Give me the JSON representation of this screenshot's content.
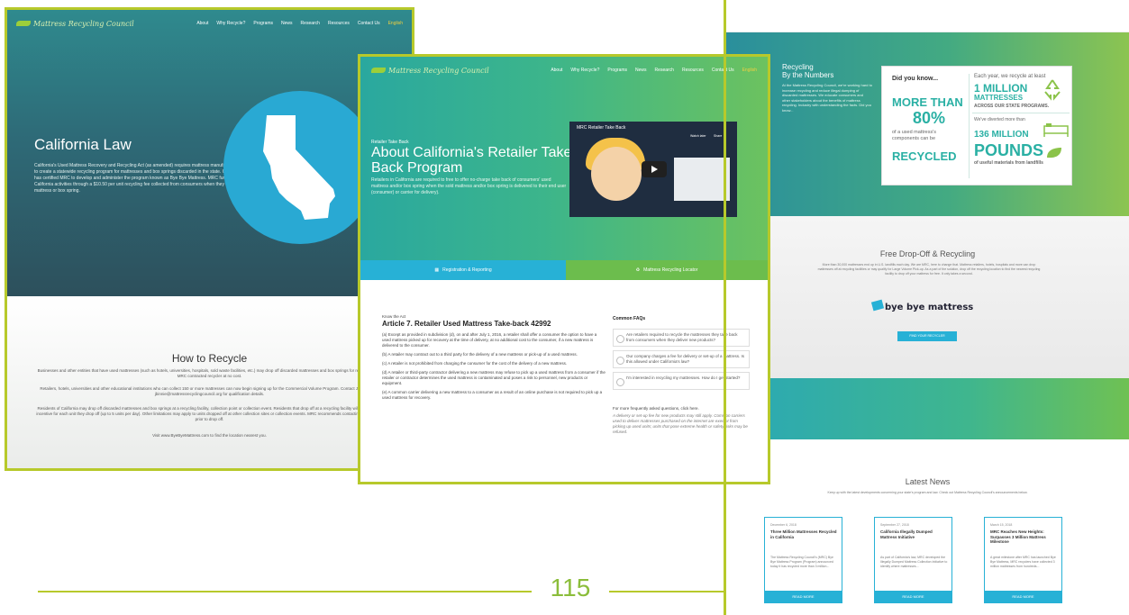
{
  "page_number": "115",
  "nav": {
    "logo": "Mattress Recycling Council",
    "links": [
      "About",
      "Why Recycle?",
      "Programs",
      "News",
      "Research",
      "Resources",
      "Contact Us"
    ],
    "language": "English"
  },
  "left_page": {
    "title": "California Law",
    "body": "California's Used Mattress Recovery and Recycling Act (as amended) requires mattress manufacturers to create a statewide recycling program for mattresses and box springs discarded in the state. California has certified MRC to develop and administer the program known as Bye Bye Mattress. MRC funds its California activities through a $10.50 per unit recycling fee collected from consumers when they buy a mattress or box spring.",
    "how_title": "How to Recycle",
    "how_p1": "Businesses and other entities that have used mattresses (such as hotels, universities, hospitals, sold waste facilities, etc.) may drop off discarded mattresses and box springs for recycling at an MRC contracted recycler at no cost.",
    "how_p2": "Retailers, hotels, universities and other educational institutions who can collect 150 or more mattresses can now begin signing up for the Commercial Volume Program. Contact Jay Binnie at jbinnie@mattressrecyclingcouncil.org for qualification details.",
    "how_p3": "Residents of California may drop off discarded mattresses and box springs at a recycling facility, collection point or collection event. Residents that drop off at a recycling facility will receive a $3 incentive for each unit they drop off (up to 5 units per day). Other limitations may apply to units dropped off at other collection sites or collection events. MRC recommends contacting the location prior to drop off.",
    "how_p4": "Visit www.ByeByeMattress.com to find the location nearest you."
  },
  "mid_page": {
    "kicker": "Retailer Take Back",
    "title": "About California's Retailer Take Back Program",
    "body": "Retailers in California are required to free to offer no-charge take back of consumers' used mattress and/or box spring when the sold mattress and/or box spring is delivered to their end user (consumer) or carrier for delivery).",
    "video_title": "MRC Retailer Take Back",
    "video_watch_later": "Watch later",
    "video_share": "Share",
    "tab1": "Registration & Reporting",
    "tab2": "Mattress Recycling Locator",
    "know_label": "Know the Act",
    "article_title": "Article 7. Retailer Used Mattress Take-back 42992",
    "law": [
      "(a) Except as provided in subdivision (d), on and after July 1, 2016, a retailer shall offer a consumer the option to have a used mattress picked up for recovery at the time of delivery, at no additional cost to the consumer, if a new mattress is delivered to the consumer.",
      "(b) A retailer may contract out to a third party for the delivery of a new mattress or pick-up of a used mattress.",
      "(c) A retailer is not prohibited from charging the consumer for the cost of the delivery of a new mattress.",
      "(d) A retailer or third-party contractor delivering a new mattress may refuse to pick up a used mattress from a consumer if the retailer or contractor determines the used mattress is contaminated and poses a risk to personnel, new products or equipment.",
      "(e) A common carrier delivering a new mattress to a consumer as a result of an online purchase is not required to pick up a used mattress for recovery."
    ],
    "faq_title": "Common FAQs",
    "faqs": [
      "Are retailers required to recycle the mattresses they take back from consumers when they deliver new products?",
      "Our company charges a fee for delivery or set-up of a mattress. Is this allowed under California's law?",
      "I'm interested in recycling my mattresses. How do I get started?"
    ],
    "faq_more": "For more frequently asked questions, click here.",
    "faq_note": "A delivery or set-up fee for new products may still apply. Common carriers used to deliver mattresses purchased on the internet are exempt from picking up used units; units that pose extreme health or safety risks may be refused."
  },
  "right_page": {
    "rbn_title_1": "Recycling",
    "rbn_title_2": "By the Numbers",
    "rbn_body": "At the Mattress Recycling Council, we're working hard to increase recycling and reduce illegal dumping of discarded mattresses. We educate consumers and other stakeholders about the benefits of mattress recycling. Industry with understanding the facts. Did you know...",
    "did_you_know": "Did you know...",
    "more_than": "MORE THAN",
    "pct": "80%",
    "used_mattress": "of a used mattress's components can be",
    "recycled": "RECYCLED",
    "each_year": "Each year, we recycle at least",
    "one_million": "1 MILLION",
    "mattresses": "MATTRESSES",
    "across": "ACROSS OUR STATE PROGRAMS.",
    "diverted": "We've diverted more than",
    "m136": "136 MILLION",
    "pounds": "POUNDS",
    "useful": "of useful materials from landfills",
    "fd_title": "Free Drop-Off & Recycling",
    "fd_body": "More than 30,000 mattresses end up in U.S. landfills each day. We are MRC, here to change that. Mattress retailers, hotels, hospitals and more can drop mattresses off at recycling facilities or may qualify for Large Volume Pick-up. As a part of the solution, drop off the recycling location to find the nearest recycling facility to drop off your mattress for free. It only takes a second.",
    "bye_logo": "bye bye mattress",
    "find_btn": "FIND YOUR RECYCLER",
    "news_title": "Latest News",
    "news_sub": "Keep up with the latest developments concerning your state's program and law. Check out Mattress Recycling Council's announcements below.",
    "news": [
      {
        "date": "December 6, 2018",
        "title": "Three Million Mattresses Recycled in California",
        "text": "The Mattress Recycling Council's (MRC) Bye Bye Mattress Program (Program) announced today it has recycled more than 3 million...",
        "btn": "READ MORE"
      },
      {
        "date": "September 27, 2018",
        "title": "California Illegally Dumped Mattress Initiative",
        "text": "As part of California's law, MRC developed the Illegally Dumped Mattress Collection Initiative to identify where mattresses...",
        "btn": "READ MORE"
      },
      {
        "date": "March 15, 2018",
        "title": "MRC Reaches New Heights: Surpasses 3 Million Mattress Milestone",
        "text": "A great milestone after MRC has launched Bye Bye Mattress, MRC recyclers have collected 3 million mattresses from hundreds...",
        "btn": "READ MORE"
      }
    ]
  },
  "colors": {
    "lime_frame": "#b7c92b",
    "teal": "#2ab0a4",
    "blue": "#27b1d6",
    "green": "#6cbd4d"
  }
}
